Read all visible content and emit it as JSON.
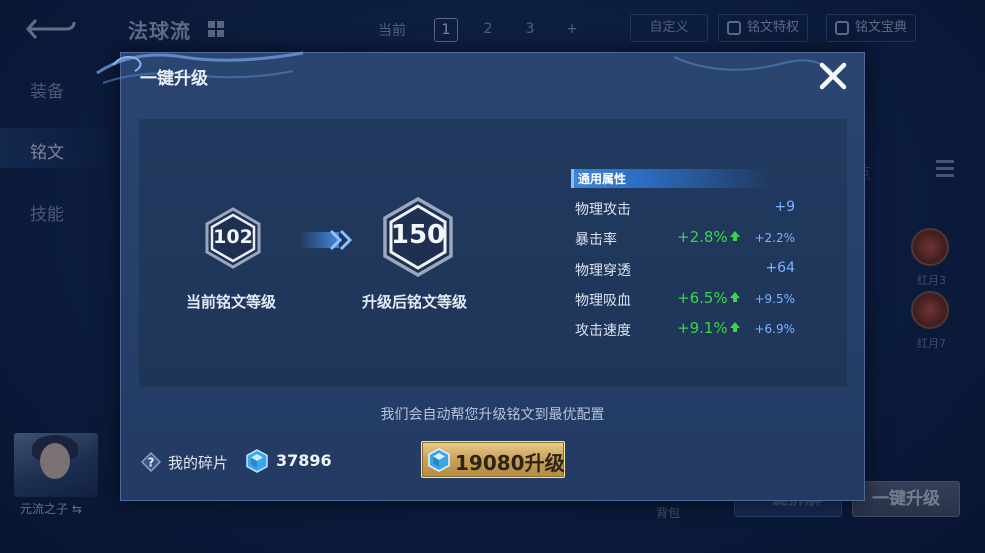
{
  "background": {
    "title": "法球流",
    "current_label": "当前",
    "pages": [
      "1",
      "2",
      "3",
      "+"
    ],
    "active_page": "1",
    "custom_label": "自定义",
    "privilege_label": "铭文特权",
    "encyclopedia_label": "铭文宝典",
    "side_nav": [
      "装备",
      "铭文",
      "技能"
    ],
    "active_side": "铭文",
    "avatar_name": "元流之子",
    "runes": [
      {
        "label": "红月3"
      },
      {
        "label": "红月7"
      }
    ],
    "bag_label": "背包",
    "btn_blue_label": "一键拆解",
    "btn_gray_label": "一键升级"
  },
  "modal": {
    "title": "一键升级",
    "current_level": "102",
    "current_level_label": "当前铭文等级",
    "target_level": "150",
    "target_level_label": "升级后铭文等级",
    "attributes_header": "通用属性",
    "attributes": [
      {
        "name": "物理攻击",
        "increase": "",
        "value": "+9"
      },
      {
        "name": "暴击率",
        "increase": "+2.8%",
        "value": "+2.2%"
      },
      {
        "name": "物理穿透",
        "increase": "",
        "value": "+64"
      },
      {
        "name": "物理吸血",
        "increase": "+6.5%",
        "value": "+9.5%"
      },
      {
        "name": "攻击速度",
        "increase": "+9.1%",
        "value": "+6.9%"
      }
    ],
    "hint": "我们会自动帮您升级铭文到最优配置",
    "fragments_label": "我的碎片",
    "fragments_count": "37896",
    "upgrade_cost": "19080",
    "upgrade_label": "升级"
  },
  "colors": {
    "increase_green": "#38d64b",
    "value_blue": "#7ab4ff",
    "button_gold": "#c9a25a"
  }
}
